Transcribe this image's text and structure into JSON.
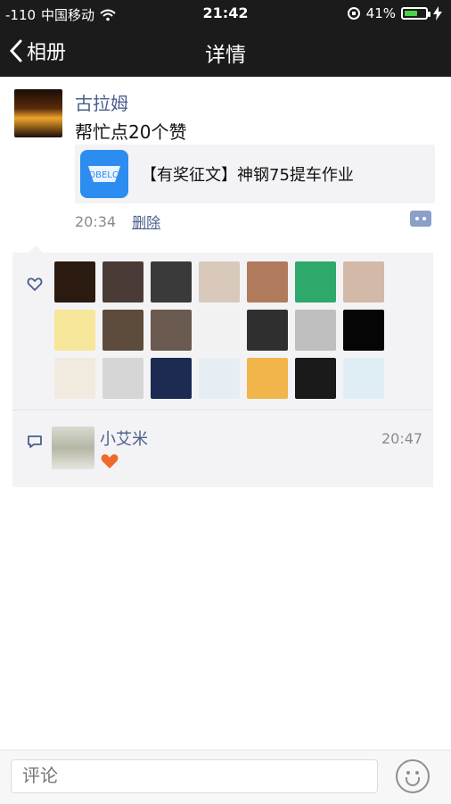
{
  "status": {
    "signal": "-110",
    "carrier": "中国移动",
    "time": "21:42",
    "battery": "41%"
  },
  "nav": {
    "back_label": "相册",
    "title": "详情"
  },
  "post": {
    "author": "古拉姆",
    "text": "帮忙点20个赞",
    "share_title": "【有奖征文】神钢75提车作业",
    "time": "20:34",
    "delete_label": "删除"
  },
  "likes": {
    "avatar_colors": [
      "#2a1a10",
      "#4b3b37",
      "#3a3a3a",
      "#d8c9bb",
      "#b07a5c",
      "#2fa86b",
      "#d3b9a8",
      "#f6e79a",
      "#5d4c3c",
      "#6b5a4f",
      "#f2f2f2",
      "#2f2f2f",
      "#bfbfbf",
      "#050505",
      "#f0eadf",
      "#d6d6d6",
      "#1d2b53",
      "#e7eef3",
      "#f2b54b",
      "#1a1a1a",
      "#dfeef5"
    ]
  },
  "comment": {
    "name": "小艾米",
    "time": "20:47",
    "emoji": "heart-emoji"
  },
  "input": {
    "placeholder": "评论"
  }
}
